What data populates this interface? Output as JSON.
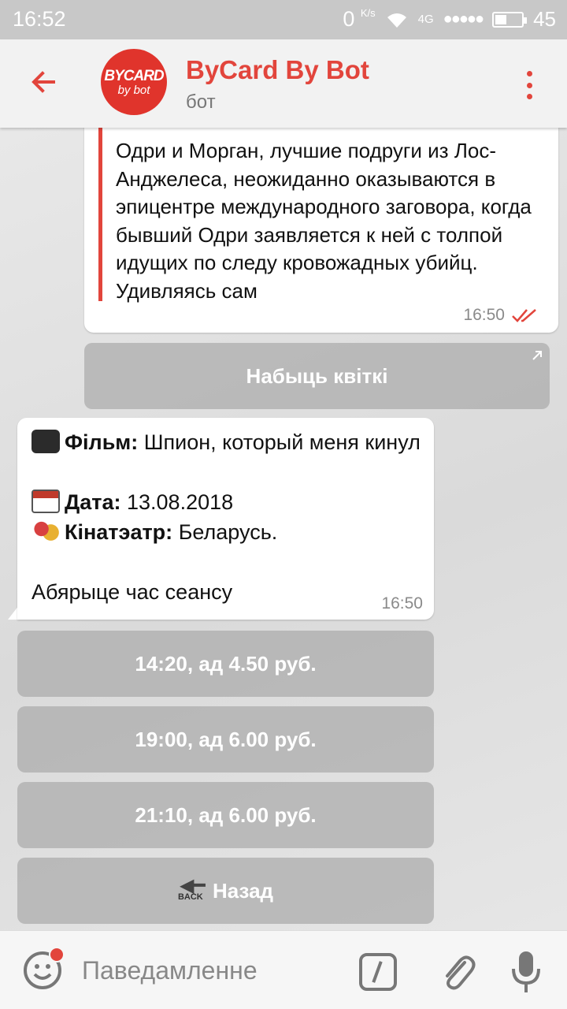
{
  "status_bar": {
    "time": "16:52",
    "speed": "0",
    "speed_unit": "K/s",
    "network": "4G",
    "signal_dots": "●●●●●",
    "battery_level": "45",
    "battery_fraction": 0.45
  },
  "header": {
    "title": "ByCard By Bot",
    "subtitle": "бот",
    "avatar_line1": "BYCARD",
    "avatar_line2": "by bot",
    "accent_color": "#e2453c"
  },
  "messages": {
    "first": {
      "quote_text": "Одри и Морган, лучшие подруги из Лос-Анджелеса, неожиданно оказываются в эпицентре международного заговора, когда бывший Одри заявляется к ней с толпой идущих по следу кровожадных убийц. Удивляясь сам",
      "time": "16:50"
    },
    "buy_button": "Набыць квіткі",
    "second": {
      "film_label": "Фільм:",
      "film_value": "Шпион, который меня кинул",
      "date_label": "Дата:",
      "date_value": "13.08.2018",
      "cinema_label": "Кінатэатр:",
      "cinema_value": "Беларусь.",
      "prompt": "Абярыце час сеансу",
      "time": "16:50"
    }
  },
  "keyboard": {
    "sessions": [
      "14:20, ад 4.50 руб.",
      "19:00, ад 6.00 руб.",
      "21:10, ад 6.00 руб."
    ],
    "back_label": "Назад",
    "back_icon_text": "BACK"
  },
  "input": {
    "placeholder": "Паведамленне"
  }
}
